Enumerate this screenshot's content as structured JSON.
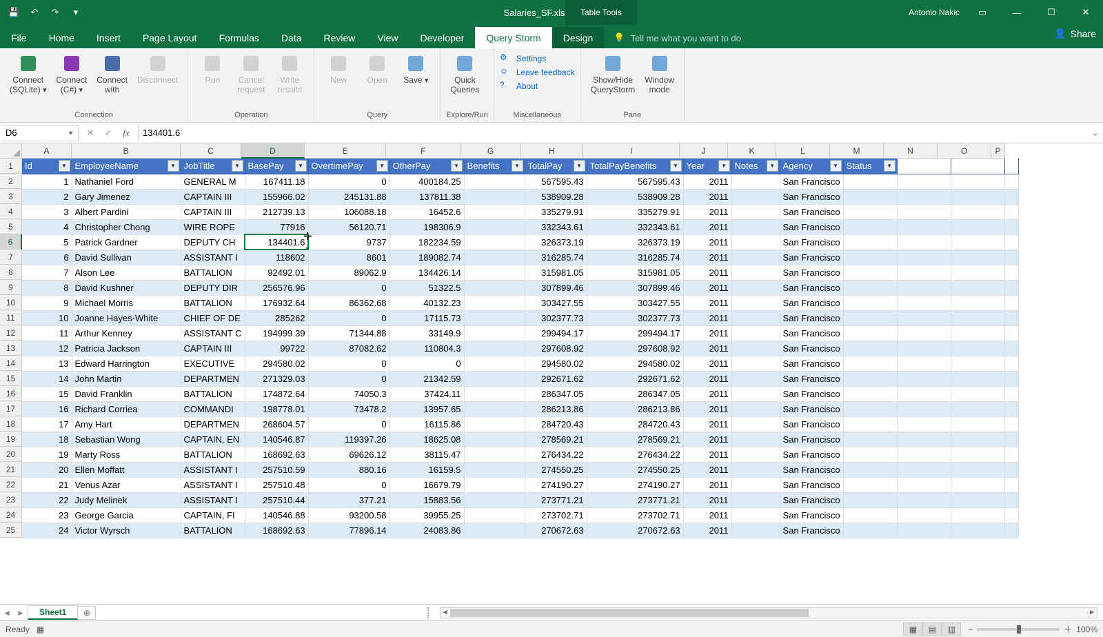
{
  "app": {
    "title": "Salaries_SF.xlsx - Excel",
    "user": "Antonio Nakic",
    "tabletools": "Table Tools"
  },
  "tabs": [
    "File",
    "Home",
    "Insert",
    "Page Layout",
    "Formulas",
    "Data",
    "Review",
    "View",
    "Developer",
    "Query Storm",
    "Design"
  ],
  "activeTab": "Query Storm",
  "tellme": "Tell me what you want to do",
  "share": "Share",
  "ribbon": {
    "groups": [
      {
        "label": "Connection",
        "buttons": [
          {
            "l1": "Connect",
            "l2": "(SQLite)",
            "dd": true,
            "color": "#107c41"
          },
          {
            "l1": "Connect",
            "l2": "(C#)",
            "dd": true,
            "color": "#7719aa"
          },
          {
            "l1": "Connect",
            "l2": "with",
            "color": "#2b579a"
          },
          {
            "l1": "Disconnect",
            "disabled": true
          }
        ]
      },
      {
        "label": "Operation",
        "buttons": [
          {
            "l1": "Run",
            "disabled": true
          },
          {
            "l1": "Cancel",
            "l2": "request",
            "disabled": true
          },
          {
            "l1": "Write",
            "l2": "results",
            "disabled": true
          }
        ]
      },
      {
        "label": "Query",
        "buttons": [
          {
            "l1": "New",
            "disabled": true
          },
          {
            "l1": "Open",
            "disabled": true
          },
          {
            "l1": "Save",
            "dd": true
          }
        ]
      },
      {
        "label": "Explore/Run",
        "buttons": [
          {
            "l1": "Quick",
            "l2": "Queries"
          }
        ]
      },
      {
        "label": "Miscellaneous",
        "misc": [
          {
            "t": "Settings",
            "i": "⚙"
          },
          {
            "t": "Leave feedback",
            "i": "☺"
          },
          {
            "t": "About",
            "i": "?"
          }
        ]
      },
      {
        "label": "Pane",
        "buttons": [
          {
            "l1": "Show/Hide",
            "l2": "QueryStorm"
          },
          {
            "l1": "Window",
            "l2": "mode"
          }
        ]
      }
    ]
  },
  "namebox": "D6",
  "formula": "134401.6",
  "colHeaders": [
    "A",
    "B",
    "C",
    "D",
    "E",
    "F",
    "G",
    "H",
    "I",
    "J",
    "K",
    "L",
    "M",
    "N",
    "O",
    "P"
  ],
  "activeCol": "D",
  "activeRow": 6,
  "tableHeader": [
    "Id",
    "EmployeeName",
    "JobTitle",
    "BasePay",
    "OvertimePay",
    "OtherPay",
    "Benefits",
    "TotalPay",
    "TotalPayBenefits",
    "Year",
    "Notes",
    "Agency",
    "Status"
  ],
  "chart_data": {
    "type": "table",
    "columns": [
      "Id",
      "EmployeeName",
      "JobTitle",
      "BasePay",
      "OvertimePay",
      "OtherPay",
      "Benefits",
      "TotalPay",
      "TotalPayBenefits",
      "Year",
      "Notes",
      "Agency",
      "Status"
    ],
    "rows": [
      [
        1,
        "Nathaniel Ford",
        "GENERAL M",
        "167411.18",
        "0",
        "400184.25",
        "",
        "567595.43",
        "567595.43",
        "2011",
        "",
        "San Francisco",
        ""
      ],
      [
        2,
        "Gary Jimenez",
        "CAPTAIN III",
        "155966.02",
        "245131.88",
        "137811.38",
        "",
        "538909.28",
        "538909.28",
        "2011",
        "",
        "San Francisco",
        ""
      ],
      [
        3,
        "Albert Pardini",
        "CAPTAIN III",
        "212739.13",
        "106088.18",
        "16452.6",
        "",
        "335279.91",
        "335279.91",
        "2011",
        "",
        "San Francisco",
        ""
      ],
      [
        4,
        "Christopher Chong",
        "WIRE ROPE",
        "77916",
        "56120.71",
        "198306.9",
        "",
        "332343.61",
        "332343.61",
        "2011",
        "",
        "San Francisco",
        ""
      ],
      [
        5,
        "Patrick Gardner",
        "DEPUTY CH",
        "134401.6",
        "9737",
        "182234.59",
        "",
        "326373.19",
        "326373.19",
        "2011",
        "",
        "San Francisco",
        ""
      ],
      [
        6,
        "David Sullivan",
        "ASSISTANT I",
        "118602",
        "8601",
        "189082.74",
        "",
        "316285.74",
        "316285.74",
        "2011",
        "",
        "San Francisco",
        ""
      ],
      [
        7,
        "Alson Lee",
        "BATTALION",
        "92492.01",
        "89062.9",
        "134426.14",
        "",
        "315981.05",
        "315981.05",
        "2011",
        "",
        "San Francisco",
        ""
      ],
      [
        8,
        "David Kushner",
        "DEPUTY DIR",
        "256576.96",
        "0",
        "51322.5",
        "",
        "307899.46",
        "307899.46",
        "2011",
        "",
        "San Francisco",
        ""
      ],
      [
        9,
        "Michael Morris",
        "BATTALION",
        "176932.64",
        "86362.68",
        "40132.23",
        "",
        "303427.55",
        "303427.55",
        "2011",
        "",
        "San Francisco",
        ""
      ],
      [
        10,
        "Joanne Hayes-White",
        "CHIEF OF DE",
        "285262",
        "0",
        "17115.73",
        "",
        "302377.73",
        "302377.73",
        "2011",
        "",
        "San Francisco",
        ""
      ],
      [
        11,
        "Arthur Kenney",
        "ASSISTANT C",
        "194999.39",
        "71344.88",
        "33149.9",
        "",
        "299494.17",
        "299494.17",
        "2011",
        "",
        "San Francisco",
        ""
      ],
      [
        12,
        "Patricia Jackson",
        "CAPTAIN III",
        "99722",
        "87082.62",
        "110804.3",
        "",
        "297608.92",
        "297608.92",
        "2011",
        "",
        "San Francisco",
        ""
      ],
      [
        13,
        "Edward Harrington",
        "EXECUTIVE",
        "294580.02",
        "0",
        "0",
        "",
        "294580.02",
        "294580.02",
        "2011",
        "",
        "San Francisco",
        ""
      ],
      [
        14,
        "John Martin",
        "DEPARTMEN",
        "271329.03",
        "0",
        "21342.59",
        "",
        "292671.62",
        "292671.62",
        "2011",
        "",
        "San Francisco",
        ""
      ],
      [
        15,
        "David Franklin",
        "BATTALION",
        "174872.64",
        "74050.3",
        "37424.11",
        "",
        "286347.05",
        "286347.05",
        "2011",
        "",
        "San Francisco",
        ""
      ],
      [
        16,
        "Richard Corriea",
        "COMMANDI",
        "198778.01",
        "73478.2",
        "13957.65",
        "",
        "286213.86",
        "286213.86",
        "2011",
        "",
        "San Francisco",
        ""
      ],
      [
        17,
        "Amy Hart",
        "DEPARTMEN",
        "268604.57",
        "0",
        "16115.86",
        "",
        "284720.43",
        "284720.43",
        "2011",
        "",
        "San Francisco",
        ""
      ],
      [
        18,
        "Sebastian Wong",
        "CAPTAIN, EN",
        "140546.87",
        "119397.26",
        "18625.08",
        "",
        "278569.21",
        "278569.21",
        "2011",
        "",
        "San Francisco",
        ""
      ],
      [
        19,
        "Marty Ross",
        "BATTALION",
        "168692.63",
        "69626.12",
        "38115.47",
        "",
        "276434.22",
        "276434.22",
        "2011",
        "",
        "San Francisco",
        ""
      ],
      [
        20,
        "Ellen Moffatt",
        "ASSISTANT I",
        "257510.59",
        "880.16",
        "16159.5",
        "",
        "274550.25",
        "274550.25",
        "2011",
        "",
        "San Francisco",
        ""
      ],
      [
        21,
        "Venus Azar",
        "ASSISTANT I",
        "257510.48",
        "0",
        "16679.79",
        "",
        "274190.27",
        "274190.27",
        "2011",
        "",
        "San Francisco",
        ""
      ],
      [
        22,
        "Judy Melinek",
        "ASSISTANT I",
        "257510.44",
        "377.21",
        "15883.56",
        "",
        "273771.21",
        "273771.21",
        "2011",
        "",
        "San Francisco",
        ""
      ],
      [
        23,
        "George Garcia",
        "CAPTAIN, FI",
        "140546.88",
        "93200.58",
        "39955.25",
        "",
        "273702.71",
        "273702.71",
        "2011",
        "",
        "San Francisco",
        ""
      ],
      [
        24,
        "Victor Wyrsch",
        "BATTALION",
        "168692.63",
        "77896.14",
        "24083.86",
        "",
        "270672.63",
        "270672.63",
        "2011",
        "",
        "San Francisco",
        ""
      ]
    ]
  },
  "sheet": {
    "name": "Sheet1"
  },
  "status": {
    "ready": "Ready",
    "zoom": "100%"
  }
}
